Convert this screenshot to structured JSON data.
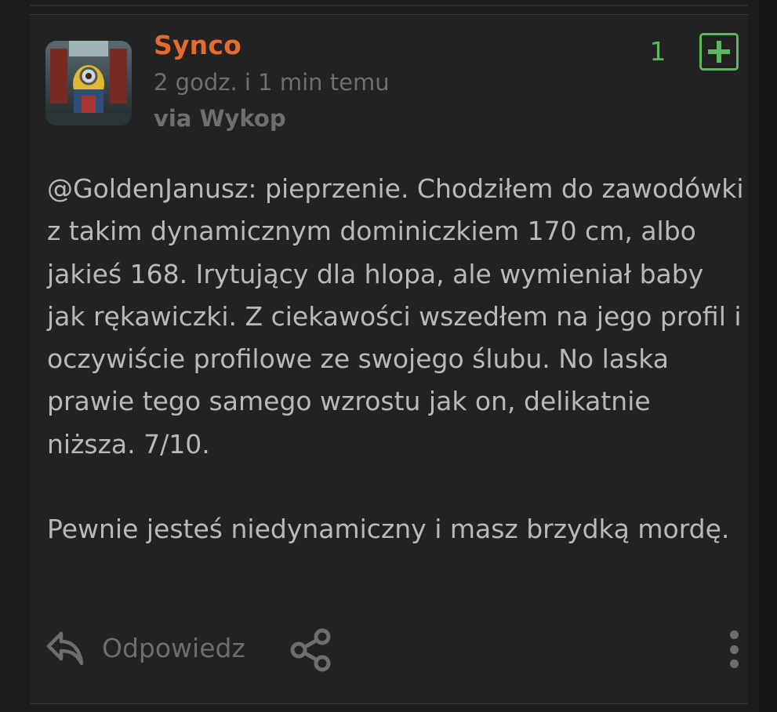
{
  "post": {
    "author": "Synco",
    "timestamp": "2 godz. i 1 min temu",
    "via": "via Wykop",
    "votes": "1",
    "body_paragraphs": [
      "@GoldenJanusz: pieprzenie. Chodziłem do zawodówki z takim dynamicznym dominiczkiem 170 cm, albo jakieś 168. Irytujący dla hlopa, ale wymieniał baby jak rękawiczki. Z ciekawości wszedłem na jego profil i oczywiście profilowe ze swojego ślubu. No laska prawie tego samego wzrostu jak on, delikatnie niższa. 7/10.",
      "Pewnie jesteś niedynamiczny i masz brzydką mordę."
    ]
  },
  "actions": {
    "reply_label": "Odpowiedz"
  },
  "icons": {
    "reply": "reply-arrow-icon",
    "share": "share-icon",
    "more": "more-vertical-icon",
    "upvote": "plus-square-icon"
  },
  "colors": {
    "username": "#e66a2c",
    "vote": "#5bb85c",
    "text": "#b9b9b9",
    "muted": "#6f6f6f",
    "card": "#222222",
    "background": "#1c1c1c"
  }
}
